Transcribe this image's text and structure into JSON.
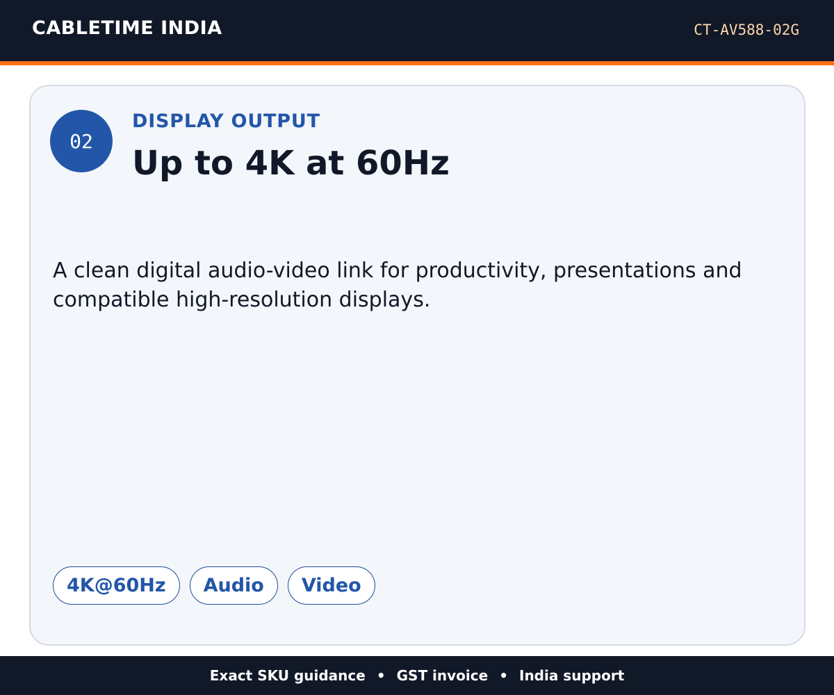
{
  "header": {
    "brand": "CABLETIME INDIA",
    "sku": "CT-AV588-02G"
  },
  "card": {
    "step": "02",
    "eyebrow": "DISPLAY OUTPUT",
    "headline": "Up to 4K at 60Hz",
    "description": "A clean digital audio-video link for productivity, presentations and compatible high-resolution displays.",
    "tags": [
      "4K@60Hz",
      "Audio",
      "Video"
    ]
  },
  "footer": {
    "items": [
      "Exact SKU guidance",
      "GST invoice",
      "India support"
    ],
    "separator": "•"
  },
  "colors": {
    "header_bg": "#111827",
    "accent": "#f97316",
    "brand_blue": "#2356a8",
    "card_bg": "#f3f6fb"
  }
}
